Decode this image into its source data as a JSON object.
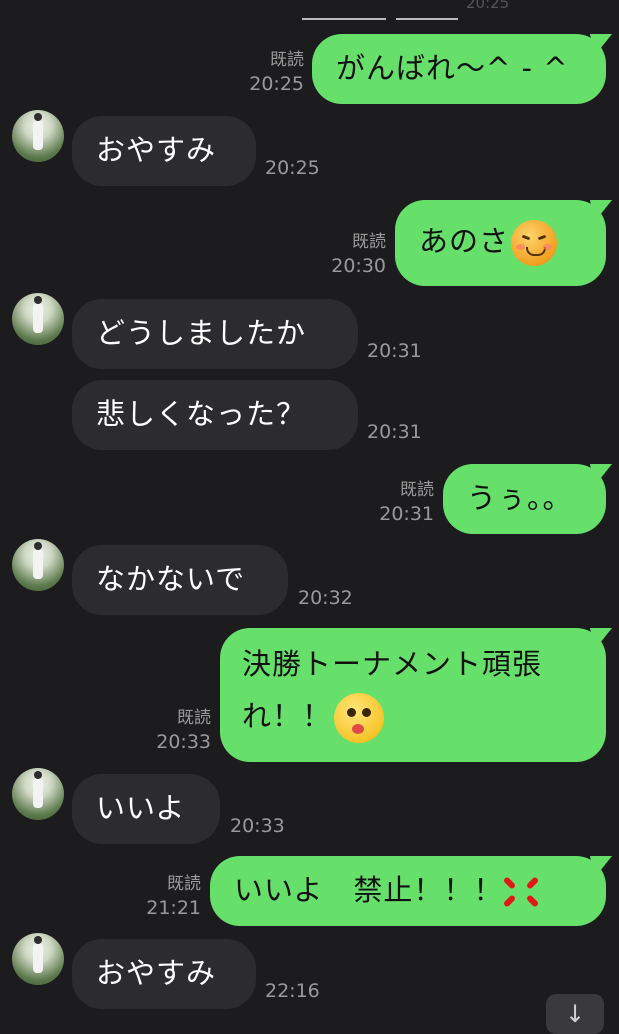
{
  "top": {
    "time_fragment": "20:25"
  },
  "read_label": "既読",
  "messages": [
    {
      "text": "がんばれ〜^ - ^",
      "time": "20:25"
    },
    {
      "text": "おやすみ",
      "time": "20:25"
    },
    {
      "text": "あのさ",
      "time": "20:30",
      "emoji": "angry-face-sticker"
    },
    {
      "text": "どうしましたか",
      "time": "20:31"
    },
    {
      "text": "悲しくなった？",
      "time": "20:31"
    },
    {
      "text": "うぅ。。",
      "time": "20:31"
    },
    {
      "text": "なかないで",
      "time": "20:32"
    },
    {
      "line1": "決勝トーナメント頑張",
      "line2": "れ！！",
      "time": "20:33",
      "emoji": "goofy-face-sticker"
    },
    {
      "text": "いいよ",
      "time": "20:33"
    },
    {
      "text": "いいよ　禁止！！！",
      "time": "21:21",
      "emoji": "anger-symbol"
    },
    {
      "text": "おやすみ",
      "time": "22:16"
    }
  ],
  "scroll_button": {
    "icon": "arrow-down-icon",
    "glyph": "↓"
  },
  "colors": {
    "background": "#1c1c1e",
    "incoming": "#2c2c2e",
    "outgoing": "#66df6b",
    "meta": "#9a9a9a"
  }
}
